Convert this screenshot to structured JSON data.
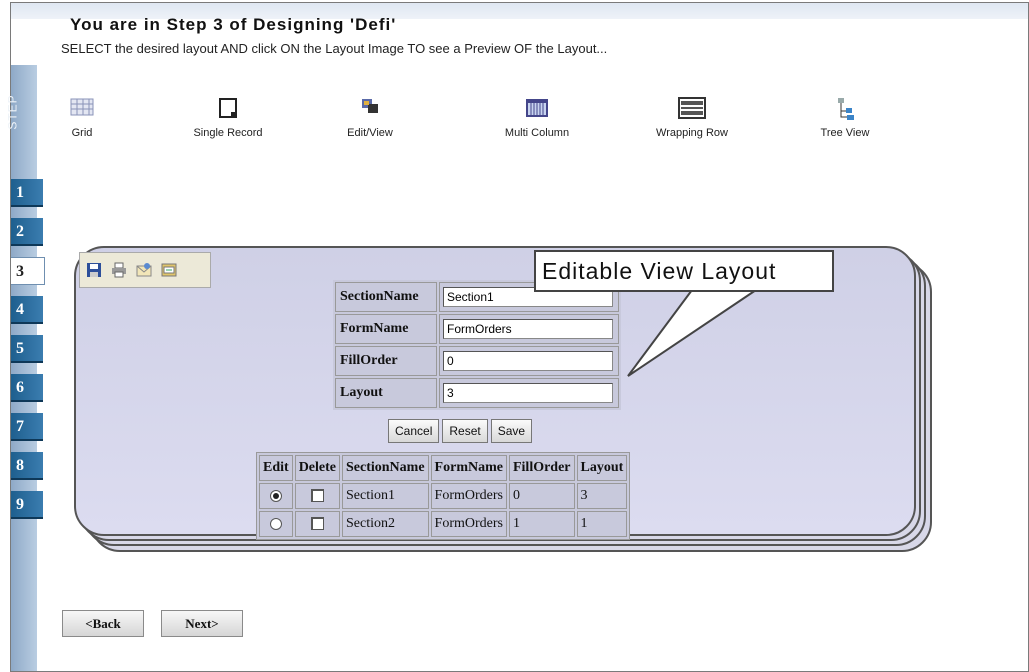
{
  "title": "You are in Step 3 of Designing 'Defi'",
  "instructions": "SELECT the desired layout AND click ON the Layout Image TO see a Preview OF the Layout...",
  "step_label": "STEP",
  "steps": [
    "1",
    "2",
    "3",
    "4",
    "5",
    "6",
    "7",
    "8",
    "9"
  ],
  "active_step": "3",
  "layouts": [
    {
      "label": "Grid",
      "icon": "grid-icon"
    },
    {
      "label": "Single Record",
      "icon": "single-record-icon"
    },
    {
      "label": "Edit/View",
      "icon": "edit-view-icon"
    },
    {
      "label": "Multi Column",
      "icon": "multi-column-icon"
    },
    {
      "label": "Wrapping Row",
      "icon": "wrapping-row-icon"
    },
    {
      "label": "Tree View",
      "icon": "tree-view-icon"
    }
  ],
  "callout": "Editable View Layout",
  "toolbar_icons": [
    "save-icon",
    "print-icon",
    "email-icon",
    "export-icon"
  ],
  "form": {
    "fields": [
      {
        "label": "SectionName",
        "value": "Section1"
      },
      {
        "label": "FormName",
        "value": "FormOrders"
      },
      {
        "label": "FillOrder",
        "value": "0"
      },
      {
        "label": "Layout",
        "value": "3"
      }
    ],
    "buttons": {
      "cancel": "Cancel",
      "reset": "Reset",
      "save": "Save"
    }
  },
  "grid": {
    "headers": [
      "Edit",
      "Delete",
      "SectionName",
      "FormName",
      "FillOrder",
      "Layout"
    ],
    "rows": [
      {
        "selected": true,
        "delete": false,
        "section": "Section1",
        "form": "FormOrders",
        "fill": "0",
        "layout": "3"
      },
      {
        "selected": false,
        "delete": false,
        "section": "Section2",
        "form": "FormOrders",
        "fill": "1",
        "layout": "1"
      }
    ]
  },
  "nav": {
    "back": "<Back",
    "next": "Next>"
  }
}
